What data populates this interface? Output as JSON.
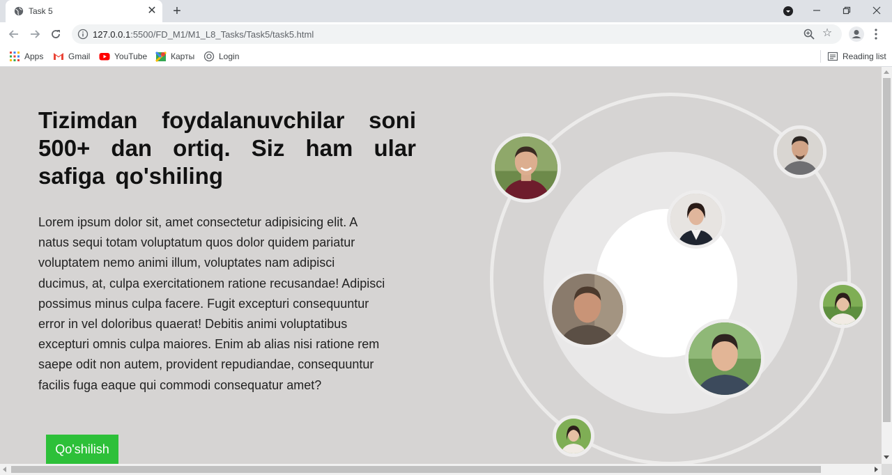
{
  "browser": {
    "tab_title": "Task 5",
    "url_host": "127.0.0.1",
    "url_path": ":5500/FD_M1/M1_L8_Tasks/Task5/task5.html"
  },
  "bookmarks": {
    "items": [
      {
        "label": "Apps",
        "icon": "apps-grid-icon"
      },
      {
        "label": "Gmail",
        "icon": "gmail-icon"
      },
      {
        "label": "YouTube",
        "icon": "youtube-icon"
      },
      {
        "label": "Карты",
        "icon": "maps-icon"
      },
      {
        "label": "Login",
        "icon": "login-icon"
      }
    ],
    "reading_list": "Reading list"
  },
  "page": {
    "headline": "Tizimdan foydalanuvchilar soni 500+ dan ortiq. Siz ham ular safiga qo'shiling",
    "body": "Lorem ipsum dolor sit, amet consectetur adipisicing elit. A natus sequi totam voluptatum quos dolor quidem pariatur voluptatem nemo animi illum, voluptates nam adipisci ducimus, at, culpa exercitationem ratione recusandae! Adipisci possimus minus culpa facere. Fugit excepturi consequuntur error in vel doloribus quaerat! Debitis animi voluptatibus excepturi omnis culpa maiores. Enim ab alias nisi ratione rem saepe odit non autem, provident repudiandae, consequuntur facilis fuga eaque qui commodi consequatur amet?",
    "join_button": "Qo'shilish"
  },
  "colors": {
    "page_background": "#d6d4d3",
    "button_green": "#2dc039",
    "ring": "#ecebea"
  }
}
